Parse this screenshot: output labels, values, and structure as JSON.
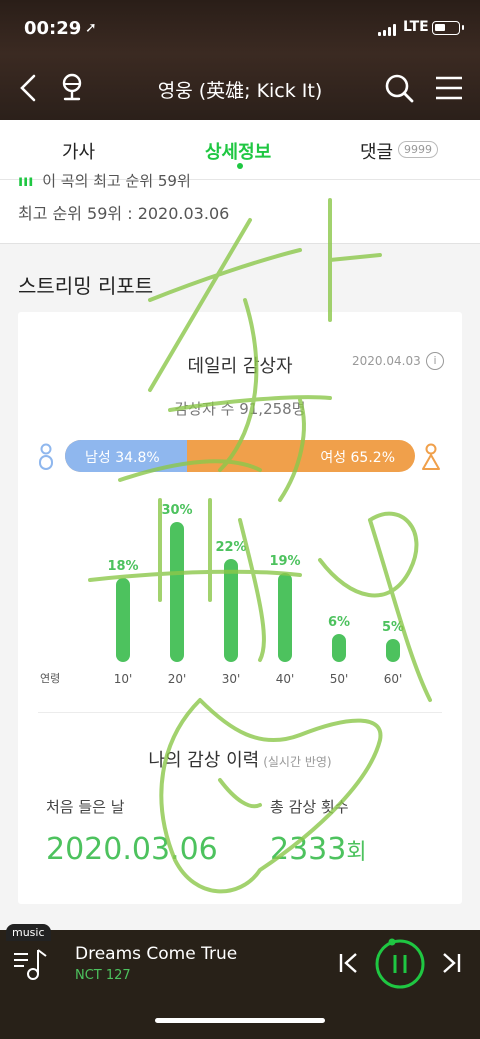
{
  "status_bar": {
    "time": "00:29",
    "network": "LTE"
  },
  "header": {
    "title": "영웅 (英雄; Kick It)"
  },
  "tabs": [
    {
      "label": "가사"
    },
    {
      "label": "상세정보",
      "active": true
    },
    {
      "label": "댓글",
      "badge": "9999"
    }
  ],
  "chart_rank": {
    "prev_line": "이 곡의 최고 순위 59위",
    "best_line": "최고 순위 59위 : 2020.03.06"
  },
  "streaming_report": {
    "section_title": "스트리밍 리포트",
    "daily_title": "데일리 감상자",
    "date": "2020.04.03",
    "listeners": "감상자 수 91,258명",
    "male_label": "남성 34.8%",
    "female_label": "여성 65.2%",
    "male_fraction": 0.348,
    "age_axis_label": "연령"
  },
  "chart_data": {
    "type": "bar",
    "title": "데일리 감상자",
    "xlabel": "연령",
    "categories": [
      "10'",
      "20'",
      "30'",
      "40'",
      "50'",
      "60'"
    ],
    "values": [
      18,
      30,
      22,
      19,
      6,
      5
    ],
    "value_labels": [
      "18%",
      "30%",
      "22%",
      "19%",
      "6%",
      "5%"
    ],
    "color": "#4dc25e"
  },
  "history": {
    "title": "나의 감상 이력",
    "subtitle": "(실시간 반영)",
    "first_label": "처음 들은 날",
    "first_value": "2020.03.06",
    "count_label": "총 감상 횟수",
    "count_value": "2333",
    "count_unit": "회"
  },
  "player": {
    "tag": "music",
    "song": "Dreams Come True",
    "artist": "NCT 127"
  },
  "colors": {
    "accent": "#1fc742",
    "bar": "#4dc25e",
    "male": "#8fb7ee",
    "female": "#f0a04b",
    "doodle": "#8cc84b"
  }
}
